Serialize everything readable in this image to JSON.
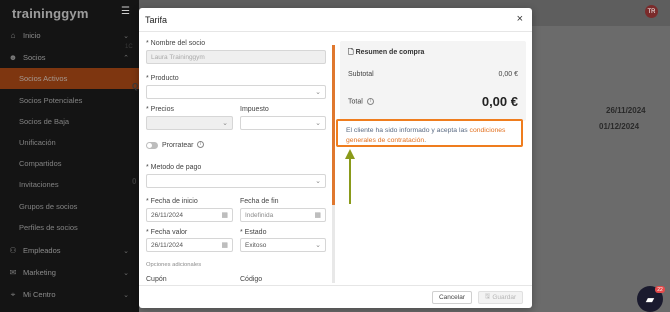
{
  "app": {
    "brand": "traininggym",
    "avatar_initials": "TR"
  },
  "sidebar": {
    "items": [
      {
        "label": "Inicio",
        "icon": "home-icon",
        "chevron": "⌄"
      },
      {
        "label": "Socios",
        "icon": "users-icon",
        "chevron": "⌃"
      },
      {
        "label": "Socios Activos"
      },
      {
        "label": "Socios Potenciales"
      },
      {
        "label": "Socios de Baja"
      },
      {
        "label": "Unificación"
      },
      {
        "label": "Compartidos"
      },
      {
        "label": "Invitaciones"
      },
      {
        "label": "Grupos de socios"
      },
      {
        "label": "Perfiles de socios"
      },
      {
        "label": "Empleados",
        "icon": "employees-icon",
        "chevron": "⌄"
      },
      {
        "label": "Marketing",
        "icon": "marketing-icon",
        "chevron": "⌄"
      },
      {
        "label": "Mi Centro",
        "icon": "center-icon",
        "chevron": "⌄"
      }
    ]
  },
  "background": {
    "date1": "26/11/2024",
    "date2": "01/12/2024",
    "frag_a": "Q",
    "frag_b": "1C",
    "frag_c": "0"
  },
  "modal": {
    "title": "Tarifa",
    "close": "×",
    "form": {
      "member_name_label": "* Nombre del socio",
      "member_name_value": "Laura Traininggym",
      "product_label": "* Producto",
      "prices_label": "* Precios",
      "tax_label": "Impuesto",
      "prorate_label": "Prorratear",
      "payment_label": "* Metodo de pago",
      "start_date_label": "* Fecha de inicio",
      "start_date_value": "26/11/2024",
      "end_date_label": "Fecha de fin",
      "end_date_placeholder": "Indefinida",
      "value_date_label": "* Fecha valor",
      "value_date_value": "26/11/2024",
      "status_label": "* Estado",
      "status_value": "Exitoso",
      "additional_options_label": "Opciones adicionales",
      "coupon_label": "Cupón",
      "code_label": "Código"
    },
    "summary": {
      "title": "Resumen de compra",
      "subtotal_label": "Subtotal",
      "subtotal_value": "0,00 €",
      "total_label": "Total",
      "total_value": "0,00 €"
    },
    "consent": {
      "text": "El cliente ha sido informado y acepta las ",
      "link": "condiciones generales de contratación",
      "end": "."
    },
    "footer": {
      "cancel": "Cancelar",
      "save": "Guardar"
    }
  },
  "chat": {
    "badge": "22"
  },
  "colors": {
    "accent": "#e2701f",
    "sidebar_bg": "#1f1f1f",
    "highlight_border": "#ef7d1e",
    "annotation_arrow": "#8a9a1a"
  }
}
